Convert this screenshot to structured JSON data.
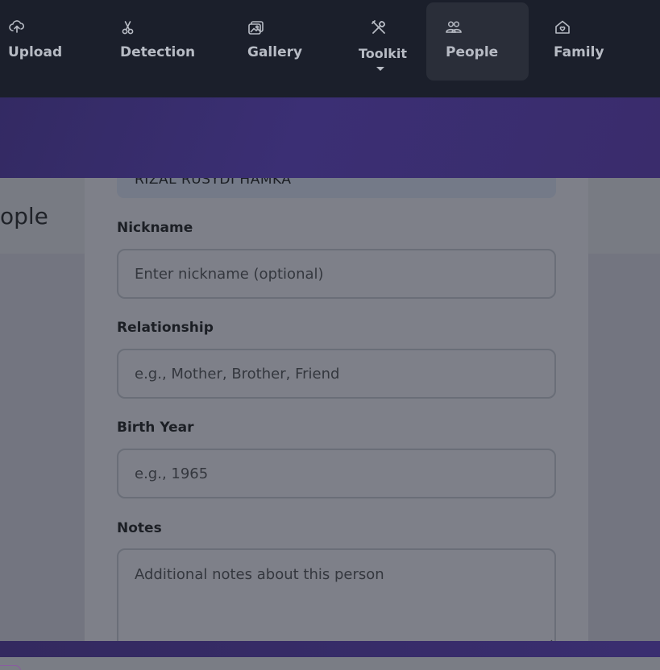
{
  "nav": {
    "items": [
      {
        "label": "Upload",
        "icon": "upload-cloud-icon"
      },
      {
        "label": "Detection",
        "icon": "scissors-icon"
      },
      {
        "label": "Gallery",
        "icon": "gallery-icon"
      },
      {
        "label": "Toolkit",
        "icon": "tools-icon"
      },
      {
        "label": "People",
        "icon": "people-icon"
      },
      {
        "label": "Family",
        "icon": "home-heart-icon"
      }
    ],
    "active": "People"
  },
  "background": {
    "page_title_fragment": "ople"
  },
  "modal": {
    "name_value_fragment": "RIZAL RUSYDI HAMKA",
    "fields": {
      "nickname": {
        "label": "Nickname",
        "placeholder": "Enter nickname (optional)"
      },
      "relationship": {
        "label": "Relationship",
        "placeholder": "e.g., Mother, Brother, Friend"
      },
      "birth_year": {
        "label": "Birth Year",
        "placeholder": "e.g., 1965"
      },
      "notes": {
        "label": "Notes",
        "placeholder": "Additional notes about this person"
      }
    }
  },
  "colors": {
    "nav_bg": "#1b1f2b",
    "banner": "#3b2f74",
    "overlay_gray": "#7e8089"
  }
}
